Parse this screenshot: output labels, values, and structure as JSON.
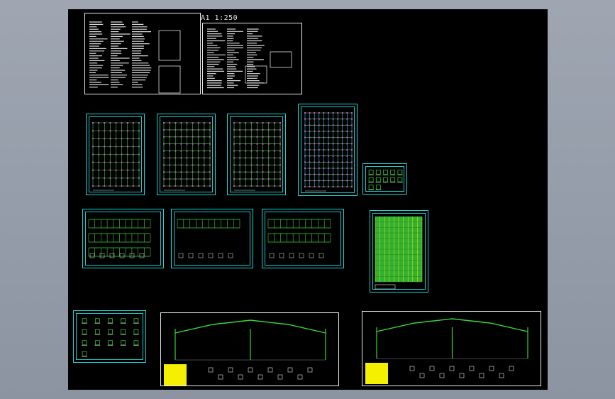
{
  "viewport": {
    "background": "#000000",
    "scale_label": "A1  1:250"
  },
  "colors": {
    "frame_white": "#e8e8e8",
    "frame_cyan": "#19d4d4",
    "line_green": "#39d63a",
    "line_magenta": "#d24bd6",
    "line_yellow": "#f4f000",
    "text_white": "#e6e6e6"
  },
  "sheets": [
    {
      "id": "general-notes-sheet",
      "kind": "notes"
    },
    {
      "id": "design-notes-sheet",
      "kind": "notes"
    },
    {
      "id": "foundation-plan-sheet",
      "kind": "plan"
    },
    {
      "id": "column-layout-sheet",
      "kind": "plan"
    },
    {
      "id": "anchor-bolt-plan-sheet",
      "kind": "plan"
    },
    {
      "id": "roof-purlin-plan-sheet",
      "kind": "plan"
    },
    {
      "id": "connection-details-sheet",
      "kind": "detail"
    },
    {
      "id": "wall-elevation-sheet-1",
      "kind": "elevation"
    },
    {
      "id": "wall-elevation-sheet-2",
      "kind": "elevation"
    },
    {
      "id": "wall-elevation-sheet-3",
      "kind": "elevation"
    },
    {
      "id": "roof-panel-layout-sheet",
      "kind": "plan"
    },
    {
      "id": "node-details-sheet",
      "kind": "detail"
    },
    {
      "id": "portal-frame-sheet-1",
      "kind": "frame"
    },
    {
      "id": "portal-frame-sheet-2",
      "kind": "frame"
    }
  ]
}
